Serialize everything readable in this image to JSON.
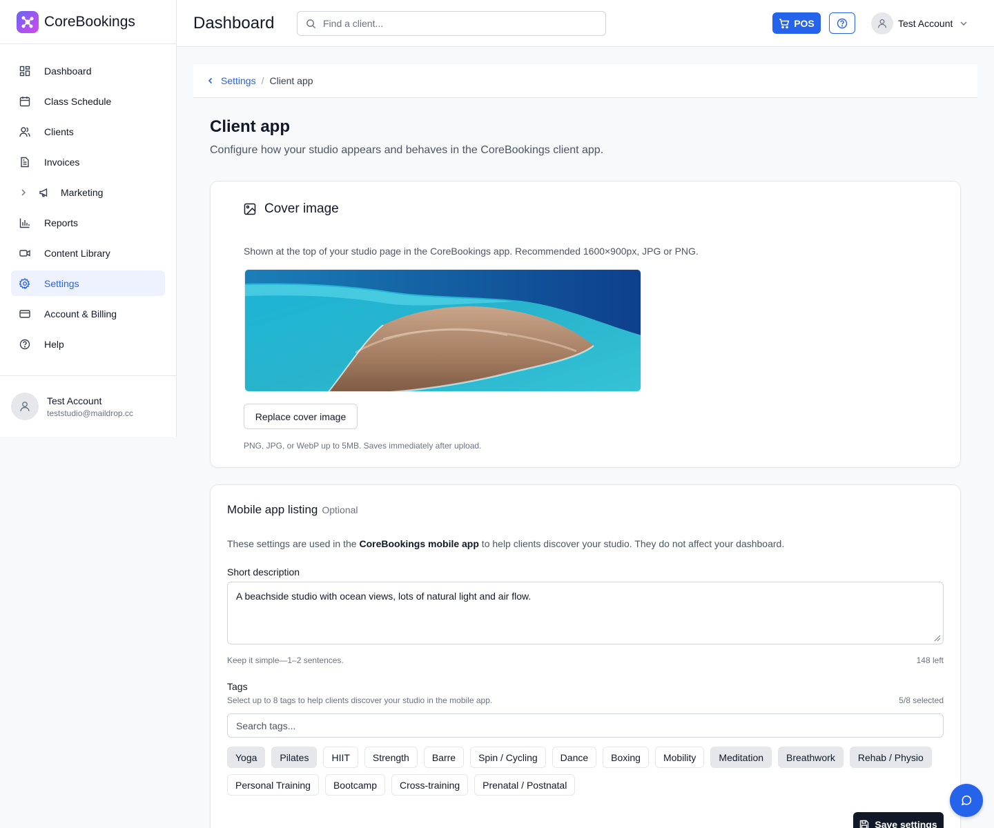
{
  "brand": {
    "name": "CoreBookings"
  },
  "sidebar": {
    "items": [
      {
        "label": "Dashboard",
        "icon": "dashboard-icon"
      },
      {
        "label": "Class Schedule",
        "icon": "calendar-icon"
      },
      {
        "label": "Clients",
        "icon": "users-icon"
      },
      {
        "label": "Invoices",
        "icon": "file-text-icon"
      },
      {
        "label": "Marketing",
        "icon": "megaphone-icon"
      },
      {
        "label": "Reports",
        "icon": "bar-chart-icon"
      },
      {
        "label": "Content Library",
        "icon": "video-icon"
      },
      {
        "label": "Settings",
        "icon": "gear-icon"
      },
      {
        "label": "Account & Billing",
        "icon": "credit-card-icon"
      },
      {
        "label": "Help",
        "icon": "help-circle-icon"
      }
    ],
    "active": "Settings",
    "user": {
      "name": "Test Account",
      "email": "teststudio@maildrop.cc"
    }
  },
  "header": {
    "title": "Dashboard",
    "search_placeholder": "Find a client...",
    "pos_label": "POS",
    "account_name": "Test Account"
  },
  "breadcrumb": {
    "parent": "Settings",
    "current": "Client app"
  },
  "page": {
    "title": "Client app",
    "subtitle": "Configure how your studio appears and behaves in the CoreBookings client app."
  },
  "cover_card": {
    "title": "Cover image",
    "description": "Shown at the top of your studio page in the CoreBookings app. Recommended 1600×900px, JPG or PNG.",
    "replace_label": "Replace cover image",
    "hint": "PNG, JPG, or WebP up to 5MB. Saves immediately after upload."
  },
  "listing_card": {
    "title": "Mobile app listing",
    "optional": "Optional",
    "desc_pre": "These settings are used in the ",
    "desc_bold": "CoreBookings mobile app",
    "desc_post": " to help clients discover your studio. They do not affect your dashboard.",
    "short_desc_label": "Short description",
    "short_desc_value": "A beachside studio with ocean views, lots of natural light and air flow.",
    "short_desc_hint": "Keep it simple—1–2 sentences.",
    "chars_left": "148 left",
    "tags_label": "Tags",
    "tags_hint": "Select up to 8 tags to help clients discover your studio in the mobile app.",
    "tags_count": "5/8 selected",
    "tags_placeholder": "Search tags...",
    "tags": [
      {
        "label": "Yoga",
        "selected": true
      },
      {
        "label": "Pilates",
        "selected": true
      },
      {
        "label": "HIIT",
        "selected": false
      },
      {
        "label": "Strength",
        "selected": false
      },
      {
        "label": "Barre",
        "selected": false
      },
      {
        "label": "Spin / Cycling",
        "selected": false
      },
      {
        "label": "Dance",
        "selected": false
      },
      {
        "label": "Boxing",
        "selected": false
      },
      {
        "label": "Mobility",
        "selected": false
      },
      {
        "label": "Meditation",
        "selected": true
      },
      {
        "label": "Breathwork",
        "selected": true
      },
      {
        "label": "Rehab / Physio",
        "selected": true
      },
      {
        "label": "Personal Training",
        "selected": false
      },
      {
        "label": "Bootcamp",
        "selected": false
      },
      {
        "label": "Cross-training",
        "selected": false
      },
      {
        "label": "Prenatal / Postnatal",
        "selected": false
      }
    ]
  },
  "save_label": "Save settings",
  "colors": {
    "accent": "#2563eb",
    "brand_gradient_start": "#6366f1",
    "brand_gradient_end": "#d946ef",
    "dark_button": "#111827"
  }
}
